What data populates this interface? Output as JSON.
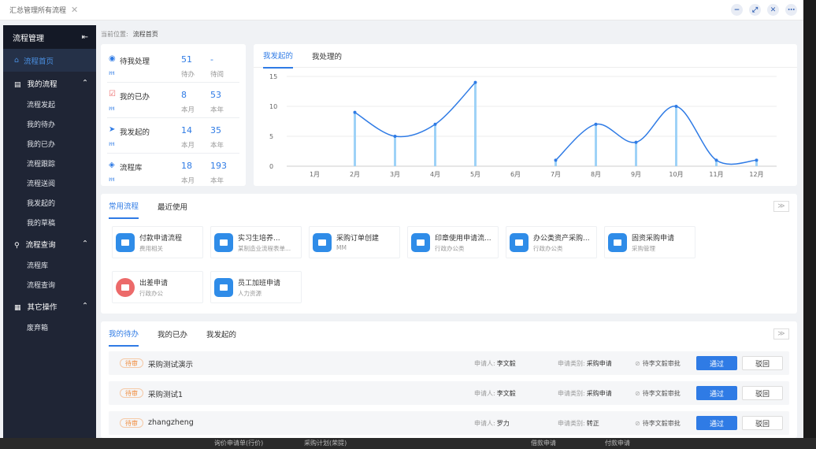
{
  "window": {
    "tab_title": "汇总管理所有流程"
  },
  "sidebar": {
    "title": "流程管理",
    "home": "流程首页",
    "groups": [
      {
        "label": "我的流程",
        "items": [
          "流程发起",
          "我的待办",
          "我的已办",
          "流程跟踪",
          "流程送阅",
          "我发起的",
          "我的草稿"
        ]
      },
      {
        "label": "流程查询",
        "items": [
          "流程库",
          "流程查询"
        ]
      },
      {
        "label": "其它操作",
        "items": [
          "废弃箱"
        ]
      }
    ]
  },
  "breadcrumb": {
    "prefix": "当前位置:",
    "current": "流程首页"
  },
  "stats": [
    {
      "label": "待我处理",
      "v1": "51",
      "l1": "待办",
      "v2": "-",
      "l2": "待阅"
    },
    {
      "label": "我的已办",
      "v1": "8",
      "l1": "本月",
      "v2": "53",
      "l2": "本年"
    },
    {
      "label": "我发起的",
      "v1": "14",
      "l1": "本月",
      "v2": "35",
      "l2": "本年"
    },
    {
      "label": "流程库",
      "v1": "18",
      "l1": "本月",
      "v2": "193",
      "l2": "本年"
    }
  ],
  "chart_tabs": [
    "我发起的",
    "我处理的"
  ],
  "chart_data": {
    "type": "line",
    "categories": [
      "1月",
      "2月",
      "3月",
      "4月",
      "5月",
      "6月",
      "7月",
      "8月",
      "9月",
      "10月",
      "11月",
      "12月"
    ],
    "values": [
      null,
      9,
      5,
      7,
      14,
      null,
      1,
      7,
      4,
      10,
      1,
      1
    ],
    "yticks": [
      0,
      5,
      10,
      15
    ],
    "ylim": [
      0,
      15
    ],
    "grid": true,
    "colors": {
      "line": "#2f7be5",
      "bar": "#9ed2f7"
    }
  },
  "freq_tabs": [
    "常用流程",
    "最近使用"
  ],
  "processes": [
    {
      "name": "付款申请流程",
      "sub": "费用相关",
      "color": "blue"
    },
    {
      "name": "实习生培养...",
      "sub": "某制造业流程表单...",
      "color": "blue"
    },
    {
      "name": "采购订单创建",
      "sub": "MM",
      "color": "blue"
    },
    {
      "name": "印章使用申请流...",
      "sub": "行政办公类",
      "color": "blue"
    },
    {
      "name": "办公类资产采购...",
      "sub": "行政办公类",
      "color": "blue"
    },
    {
      "name": "固资采购申请",
      "sub": "采购管理",
      "color": "blue"
    },
    {
      "name": "出差申请",
      "sub": "行政办公",
      "color": "red"
    },
    {
      "name": "员工加班申请",
      "sub": "人力资源",
      "color": "blue"
    }
  ],
  "todo_tabs": [
    "我的待办",
    "我的已办",
    "我发起的"
  ],
  "todos": [
    {
      "badge": "待审",
      "title": "采购测试演示",
      "applicant_label": "申请人:",
      "applicant": "李文毅",
      "type_label": "申请类别:",
      "type": "采购申请",
      "pending": "待李文毅审批",
      "pass": "通过",
      "reject": "驳回"
    },
    {
      "badge": "待审",
      "title": "采购测试1",
      "applicant_label": "申请人:",
      "applicant": "李文毅",
      "type_label": "申请类别:",
      "type": "采购申请",
      "pending": "待李文毅审批",
      "pass": "通过",
      "reject": "驳回"
    },
    {
      "badge": "待审",
      "title": "zhangzheng",
      "applicant_label": "申请人:",
      "applicant": "罗力",
      "type_label": "申请类别:",
      "type": "转正",
      "pending": "待李文毅审批",
      "pass": "通过",
      "reject": "驳回"
    }
  ],
  "background_strip": [
    "询价申请单(行价)",
    "采购计划(荣提)",
    "借款申请",
    "付款申请"
  ]
}
